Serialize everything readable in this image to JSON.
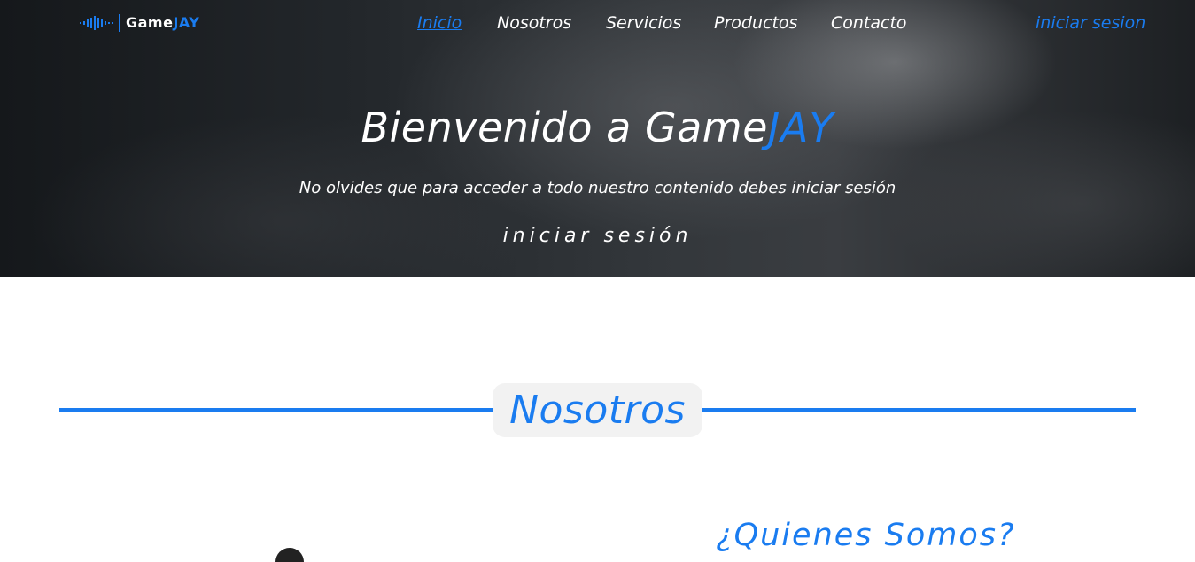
{
  "brand": {
    "name_part1": "Game",
    "name_part2": "JAY",
    "accent_color": "#1a7cf0"
  },
  "nav": {
    "items": [
      {
        "label": "Inicio",
        "active": true
      },
      {
        "label": "Nosotros",
        "active": false
      },
      {
        "label": "Servicios",
        "active": false
      },
      {
        "label": "Productos",
        "active": false
      },
      {
        "label": "Contacto",
        "active": false
      }
    ],
    "login_label": "iniciar sesion"
  },
  "hero": {
    "title_part1": "Bienvenido a Game",
    "title_part2": "JAY",
    "subtitle": "No olvides que para acceder a todo nuestro contenido debes iniciar sesión",
    "button_label": "iniciar sesión"
  },
  "about": {
    "section_title": "Nosotros",
    "heading": "¿Quienes Somos?"
  }
}
